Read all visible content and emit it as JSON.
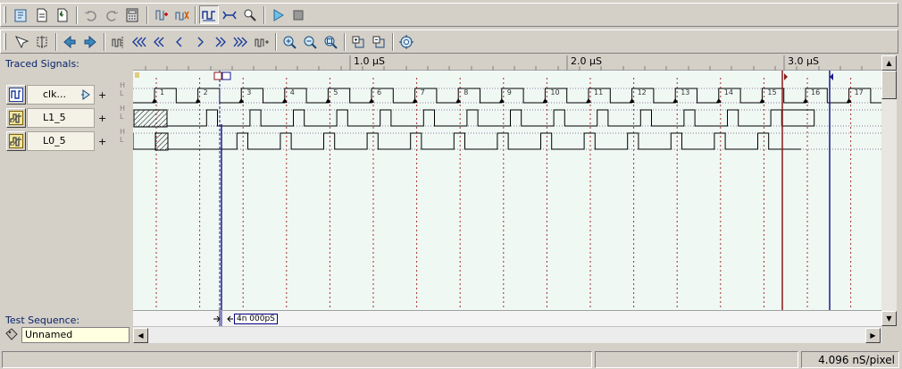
{
  "toolbar1": {
    "icons": [
      "open-project-icon",
      "new-file-icon",
      "save-file-icon",
      "undo-icon",
      "redo-icon",
      "calculator-icon",
      "add-signal-icon",
      "clock-settings-icon",
      "waveform-mode-icon",
      "bus-icon",
      "find-icon",
      "run-icon",
      "stop-icon"
    ]
  },
  "toolbar2": {
    "icons": [
      "select-cursor-icon",
      "insert-cursor-icon",
      "prev-transition-icon",
      "next-transition-icon",
      "cursor-set-icon",
      "first-icon",
      "fast-back-icon",
      "back-icon",
      "forward-icon",
      "fast-forward-icon",
      "last-icon",
      "cursor-end-icon",
      "zoom-in-icon",
      "zoom-out-icon",
      "zoom-fit-icon",
      "expand-icon",
      "collapse-icon",
      "settings-icon"
    ]
  },
  "panel": {
    "traced_label": "Traced Signals:",
    "test_sequence_label": "Test Sequence:",
    "test_sequence_value": "Unnamed"
  },
  "signals": [
    {
      "name": "clk...",
      "icon": "clock-icon",
      "hl": [
        "H",
        "L"
      ]
    },
    {
      "name": "L1_5",
      "icon": "signal-icon",
      "hl": [
        "H",
        "L"
      ]
    },
    {
      "name": "L0_5",
      "icon": "signal-icon",
      "hl": [
        "H",
        "L"
      ]
    }
  ],
  "timeline": {
    "ticks": [
      "1.0 µS",
      "2.0 µS",
      "3.0 µS"
    ],
    "cycle_numbers": [
      "1",
      "2",
      "3",
      "4",
      "5",
      "6",
      "7",
      "8",
      "9",
      "10",
      "11",
      "12",
      "13",
      "14",
      "15",
      "16",
      "17"
    ],
    "measure_label": "4n 000pS"
  },
  "status": {
    "resolution": "4.096 nS/pixel"
  },
  "colors": {
    "wave_bg": "#f0f8f4",
    "cursor_red": "#8b1a1a",
    "cursor_blue": "#1a1a8b",
    "label_blue": "#0a246a"
  }
}
